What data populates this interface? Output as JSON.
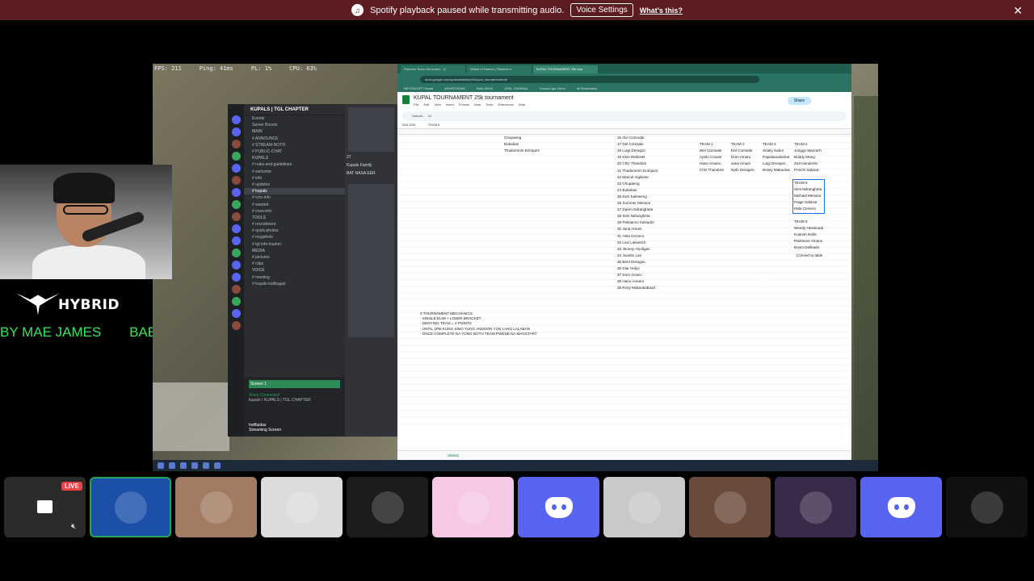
{
  "banner": {
    "message": "Spotify playback paused while transmitting audio.",
    "voice_settings": "Voice Settings",
    "whats_this": "What's this?",
    "close_glyph": "✕",
    "spotify_icon": "spotify-icon"
  },
  "game_hud": {
    "fps": "FPS: 211",
    "ping": "Ping: 41ms",
    "pl": "PL: 1%",
    "cpu": "CPU: 63%"
  },
  "discord": {
    "server_name": "KUPALS | TGL CHAPTER",
    "channels": [
      {
        "label": "Events",
        "type": "item"
      },
      {
        "label": "Server Boosts",
        "type": "item"
      },
      {
        "label": "MAIN",
        "type": "cat"
      },
      {
        "label": "# ANNOUNCE",
        "type": "item"
      },
      {
        "label": "# STREAM-NOTIF",
        "type": "item"
      },
      {
        "label": "# PUBLIC-CHAT",
        "type": "item"
      },
      {
        "label": "KUPALS",
        "type": "cat"
      },
      {
        "label": "# rules-and-guidelines",
        "type": "item"
      },
      {
        "label": "# welcome",
        "type": "item"
      },
      {
        "label": "# info",
        "type": "item"
      },
      {
        "label": "# updates",
        "type": "item"
      },
      {
        "label": "# kupals",
        "type": "active"
      },
      {
        "label": "# cctv-info",
        "type": "item"
      },
      {
        "label": "# wanted",
        "type": "item"
      },
      {
        "label": "# crew-info",
        "type": "item"
      },
      {
        "label": "TOOLS",
        "type": "cat"
      },
      {
        "label": "# recruitment",
        "type": "item"
      },
      {
        "label": "# quick-photos",
        "type": "item"
      },
      {
        "label": "# mugshots",
        "type": "item"
      },
      {
        "label": "# tgl-info-tracker",
        "type": "item"
      },
      {
        "label": "MEDIA",
        "type": "cat"
      },
      {
        "label": "# pictures",
        "type": "item"
      },
      {
        "label": "# clips",
        "type": "item"
      },
      {
        "label": "VOICE",
        "type": "cat"
      },
      {
        "label": "# meeting",
        "type": "item"
      },
      {
        "label": "# kupals-kalibugan",
        "type": "item"
      }
    ],
    "screen_share": "Screen 1",
    "voice_status": "Voice Connected",
    "voice_channel": "kupals / KUPALS | TGL CHAPTER",
    "username": "hotfluidas",
    "user_status": "Streaming Screen",
    "chat_msgs": [
      "Kupals Family",
      "BAT NASA EER"
    ],
    "count_badge": "27"
  },
  "browser": {
    "tabs": [
      {
        "label": "Random Team Generator - Q",
        "active": false
      },
      {
        "label": "Wheel of Names | Random n",
        "active": false
      },
      {
        "label": "KUPAL TOURNAMENT 25k tour",
        "active": true
      }
    ],
    "url": "docs.google.com/spreadsheets/d/1kupal_tournament/edit",
    "bookmarks": [
      "NEXTADOPT Social",
      "ARMSTRONG",
      "BAN ARUS",
      "UPAL JOURNAL",
      "Kuuad Ligo Client",
      "All Bookmarks"
    ],
    "sheet_title": "KUPAL TOURNAMENT 25k tournament",
    "menu": [
      "File",
      "Edit",
      "View",
      "Insert",
      "Format",
      "Data",
      "Tools",
      "Extensions",
      "Help"
    ],
    "share": "Share",
    "toolbar_font": "Default...",
    "toolbar_size": "10",
    "cell_ref": "N24 N28",
    "formula": "TEAM 5",
    "sheet_tab": "Sheet1"
  },
  "sheet": {
    "col_a": [
      "Chupaeng",
      "Bubabas",
      "Thadommm Enriquez"
    ],
    "players": [
      "16 Alvi Comodar",
      "17 Del Comsale",
      "18 Luigi Deragon",
      "19 Klen Retilosts",
      "20 Chiz Thandore",
      "21 Thadommm Enriquez",
      "22 Marcel Vigilante",
      "23 Chupaeng",
      "24 Bubabas",
      "25 Kiez Kaleweng",
      "26 Summer Menace",
      "27 Daren Ndrangheta",
      "28 Simi Ndrangheta",
      "29 Piebianco Salvador",
      "30 Jana Amani",
      "31 Hela Cervero",
      "32 Lexi Laksetich",
      "33 Jhoney Hooligan",
      "34 Juanito Lao",
      "35 Bent Deragon",
      "36 Diar Holyo",
      "37 Dom Amaru",
      "38 Hano Aonero",
      "39 Roxy Makaukabaud"
    ],
    "team_headers": [
      "TEAM 1",
      "TEAM 2",
      "TEAM 3",
      "TEAM 4"
    ],
    "team_rows": [
      [
        "Wei Comsale",
        "Del Comsale",
        "Snaky Sabur",
        "Jonggo Macrach"
      ],
      [
        "Apolo Cruwer",
        "Dom Amaru",
        "Papalaouabobot",
        "Buddy Mang"
      ],
      [
        "Hano Amanu",
        "Jana Amani",
        "Luigi Deragon",
        "Zod Harukrelu"
      ],
      [
        "Chiz Thandore",
        "Nafo Deragon",
        "Bossy Makaulua",
        "Ponchi Salazar"
      ]
    ],
    "team5_header": "TEAM 5",
    "team5": [
      "Simi Ndrangheta",
      "Michael Menace",
      "Paige Salazar",
      "Hela Cervero"
    ],
    "team6_header": "TEAM 6",
    "team6": [
      "Wendy Hesuloadi",
      "Kuanon Evilis",
      "Rainbone Amano",
      "Boom Delikado"
    ],
    "convert_hint": "Convert to table",
    "mechanics": [
      "# TOURNAMENT MECHANICS",
      "- SINGLE ELIM + LOSER BRACKET",
      "- DENYING TEAM = 3 POINTS",
      "- UNTIL 3PM KUNG SINO YUNG ANDOON YUN LANG LALABAN",
      "- ONCE COMPLETE NA YONG BOTH TEAM PWEDE NA MAGSTART"
    ]
  },
  "overlay": {
    "logo": "HYBRID",
    "ticker": "BY MAE JAMES",
    "ticker_tail": "BAE"
  },
  "participants": {
    "live_badge": "LIVE",
    "tiles": [
      {
        "name": "stream-preview",
        "color": "#2b2b2b"
      },
      {
        "name": "avatar-open-epic",
        "color": "#1b4fa8"
      },
      {
        "name": "avatar-selfie",
        "color": "#a37a62"
      },
      {
        "name": "avatar-cartoon",
        "color": "#dcdcdc"
      },
      {
        "name": "avatar-portrait",
        "color": "#1c1c1c"
      },
      {
        "name": "avatar-baby-pink-frame",
        "color": "#f7c8e6"
      },
      {
        "name": "avatar-discord-default",
        "color": "#5865f2"
      },
      {
        "name": "avatar-mask-graphic",
        "color": "#c9c9c9"
      },
      {
        "name": "avatar-boy",
        "color": "#6a4a3a"
      },
      {
        "name": "avatar-neon-car",
        "color": "#3a2a4a"
      },
      {
        "name": "avatar-discord-default-2",
        "color": "#5865f2"
      },
      {
        "name": "avatar-dark-silhouette",
        "color": "#111111"
      }
    ]
  },
  "colors": {
    "banner": "#5c1c20",
    "discord_blurple": "#5865f2",
    "ticker_green": "#33e65a",
    "sheets_green": "#188038"
  }
}
